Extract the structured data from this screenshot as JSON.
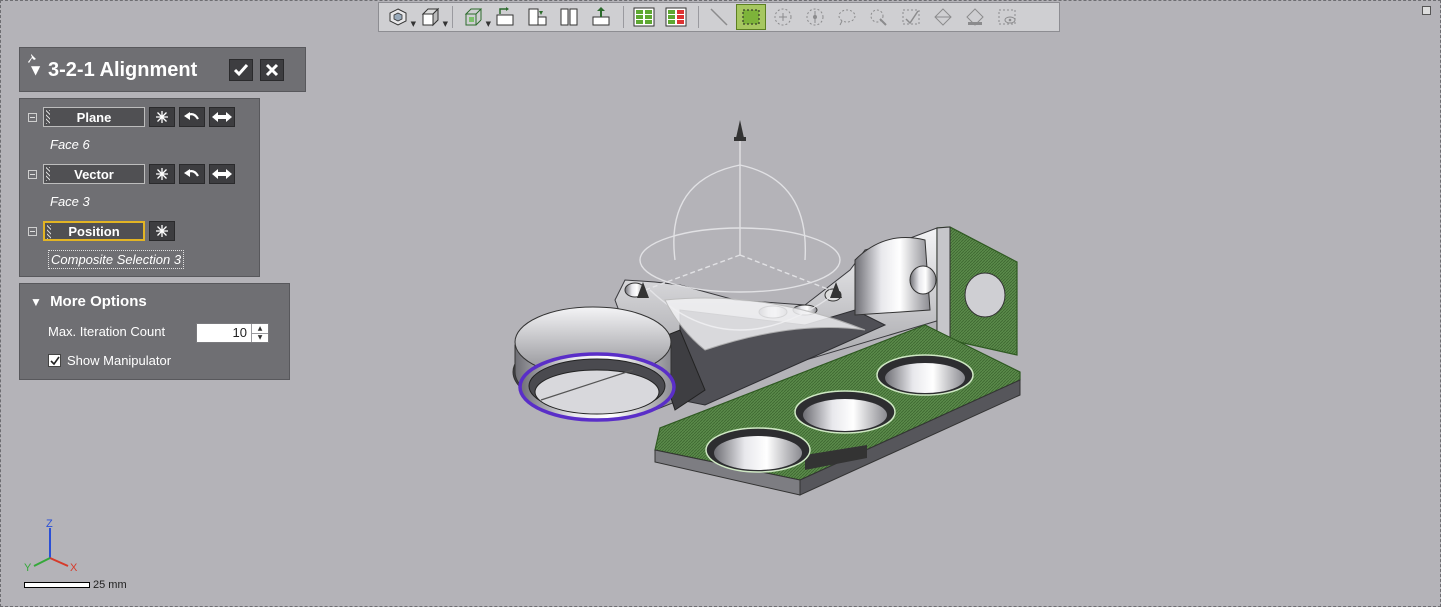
{
  "dialog": {
    "title": "3-2-1 Alignment",
    "ok_icon": "checkmark-icon",
    "cancel_icon": "close-icon"
  },
  "selections": [
    {
      "label": "Plane",
      "value": "Face 6"
    },
    {
      "label": "Vector",
      "value": "Face 3"
    },
    {
      "label": "Position",
      "value": "Composite Selection 3"
    }
  ],
  "more_options": {
    "title": "More Options",
    "max_iteration_label": "Max. Iteration Count",
    "max_iteration_value": "10",
    "show_manipulator_label": "Show Manipulator",
    "show_manipulator_checked": true
  },
  "toolbar": {
    "icons": [
      "view-cube-icon",
      "box-view-icon",
      "wireframe-box-icon",
      "align-left-icon",
      "align-bottom-icon",
      "split-view-icon",
      "move-part-icon",
      "grid-layout-icon",
      "list-split-icon",
      "line-select-icon",
      "box-select-icon",
      "circle-select-icon",
      "target-select-icon",
      "lasso-select-icon",
      "paint-select-icon",
      "check-select-icon",
      "shape-select-icon",
      "fill-select-icon",
      "eye-select-icon"
    ],
    "active": "box-select-icon"
  },
  "triad": {
    "z": "Z",
    "y": "Y",
    "x": "X"
  },
  "scale": {
    "label": "25 mm"
  },
  "colors": {
    "background": "#b4b3b8",
    "panel": "#6f6f73",
    "highlight_green": "#4c8a3a",
    "selection_purple": "#5a2ec8",
    "focus_gold": "#e2b424"
  }
}
